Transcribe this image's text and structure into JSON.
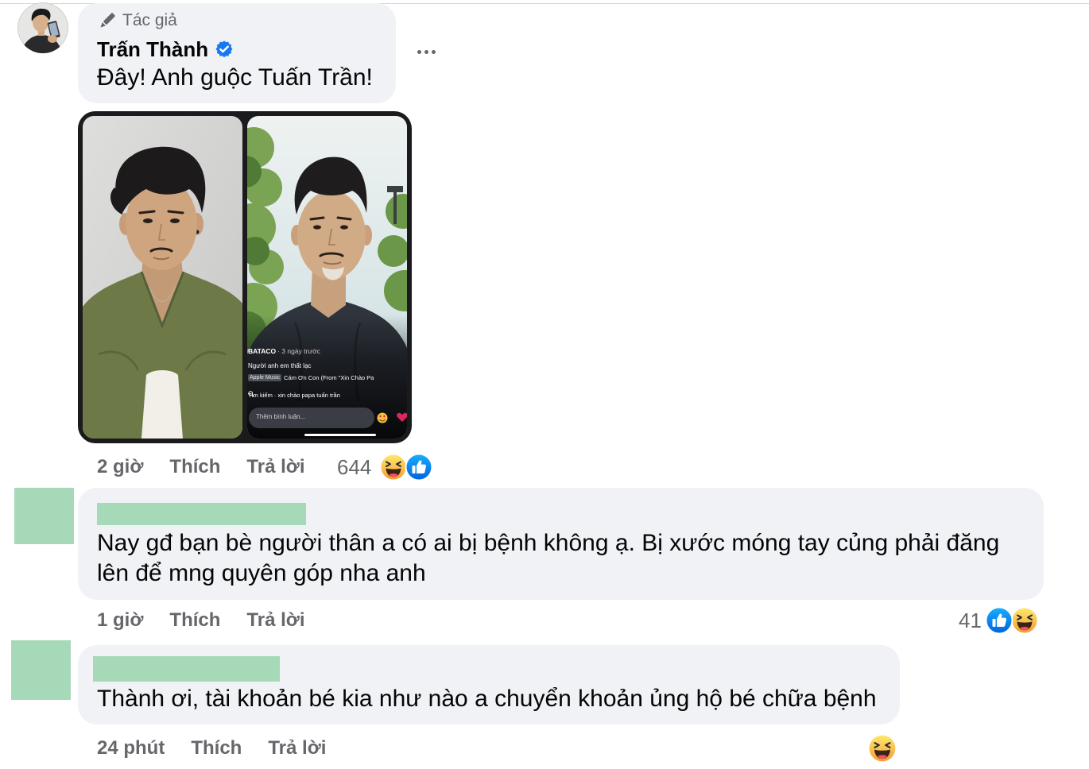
{
  "colors": {
    "bubble": "#f0f2f5",
    "text": "#050505",
    "secondary": "#65676b",
    "redaction": "#a6d9b8",
    "accent": "#1877f2"
  },
  "comments": [
    {
      "badge_icon": "pen-icon",
      "badge": "Tác giả",
      "author": "Trấn Thành",
      "verified": true,
      "text": "Đây! Anh guộc Tuấn Trần!",
      "attachment": {
        "channel": "BATACO",
        "posted": "· 3 ngày trước",
        "caption": "Người anh em thất lạc",
        "music_badge": "Apple Music",
        "music_track": "Cám Ơn Con (From \"Xin Chào Pa",
        "search": "Tìm kiếm · xin chào papa tuấn trần",
        "comment_placeholder": "Thêm bình luận..."
      },
      "time": "2 giờ",
      "like_label": "Thích",
      "reply_label": "Trả lời",
      "reaction_count": "644",
      "reactions": [
        "haha-icon",
        "like-icon"
      ]
    },
    {
      "text": "Nay gđ bạn bè người thân a có ai bị bệnh không ạ. Bị xước móng tay củng phải đăng lên để mng quyên góp nha anh",
      "time": "1 giờ",
      "like_label": "Thích",
      "reply_label": "Trả lời",
      "reaction_count": "41",
      "reactions": [
        "like-icon",
        "haha-icon"
      ]
    },
    {
      "text": "Thành ơi, tài khoản bé kia như nào a chuyển khoản ủng hộ bé chữa bệnh",
      "time": "24 phút",
      "like_label": "Thích",
      "reply_label": "Trả lời",
      "reactions": [
        "haha-icon"
      ]
    }
  ]
}
